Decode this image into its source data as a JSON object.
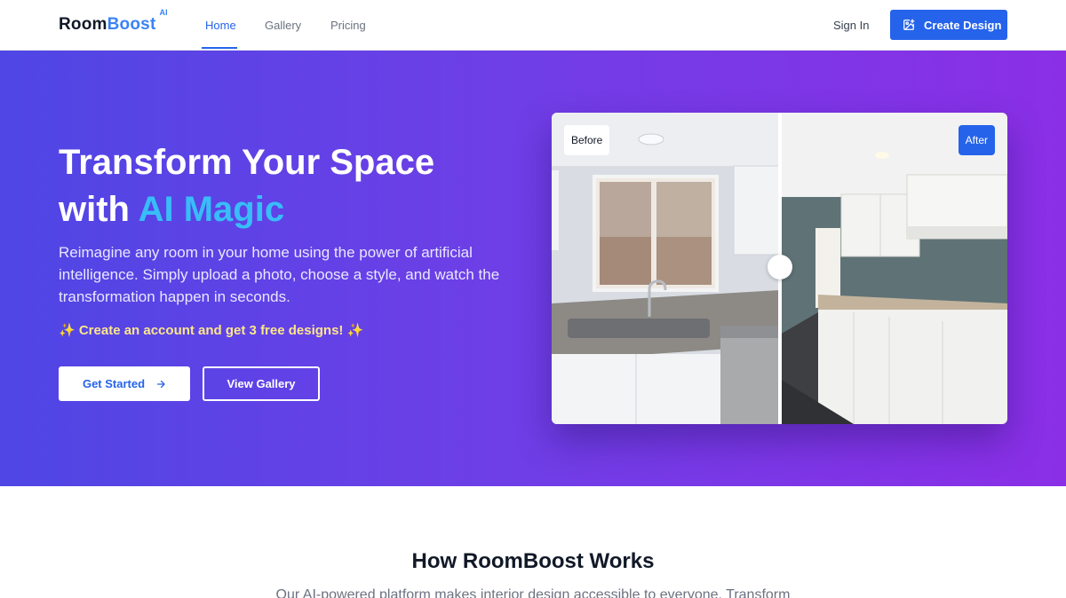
{
  "header": {
    "logo_room": "Room",
    "logo_boost": "Boost",
    "logo_sup": "AI",
    "nav": [
      {
        "label": "Home",
        "active": true
      },
      {
        "label": "Gallery",
        "active": false
      },
      {
        "label": "Pricing",
        "active": false
      }
    ],
    "signin_label": "Sign In",
    "create_label": "Create Design",
    "create_icon": "image-edit-icon"
  },
  "hero": {
    "title_line1": "Transform Your Space",
    "title_with": "with ",
    "title_accent": "AI Magic",
    "description": "Reimagine any room in your home using the power of artificial intelligence. Simply upload a photo, choose a style, and watch the transformation happen in seconds.",
    "promo": "✨ Create an account and get 3 free designs! ✨",
    "start_label": "Get Started",
    "gallery_label": "View Gallery",
    "compare": {
      "before_label": "Before",
      "after_label": "After"
    }
  },
  "section": {
    "title": "How RoomBoost Works",
    "subtitle": "Our AI-powered platform makes interior design accessible to everyone. Transform"
  },
  "colors": {
    "primary": "#2563eb",
    "accent": "#38bdf8",
    "hero_start": "#4f46e5",
    "hero_end": "#8b2fe6"
  }
}
